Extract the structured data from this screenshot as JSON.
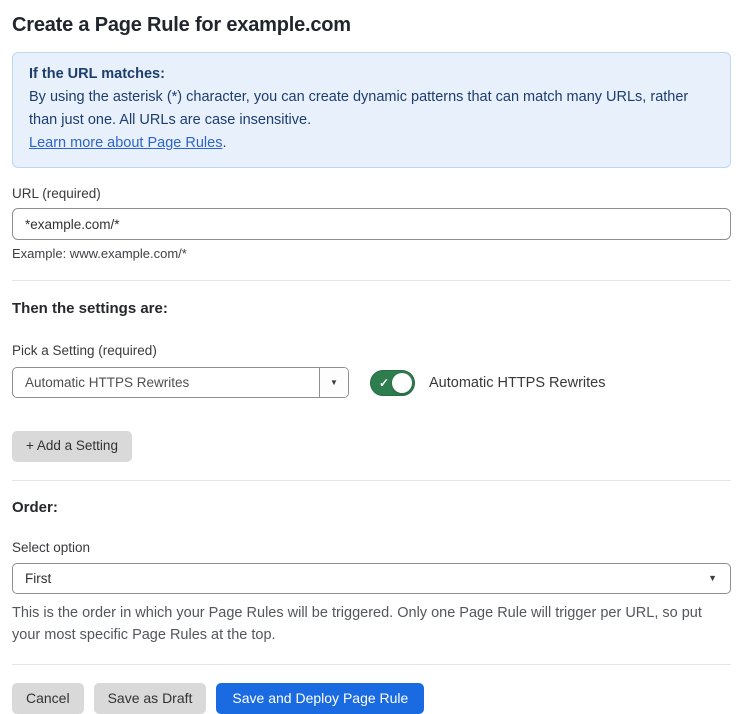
{
  "page_title": "Create a Page Rule for example.com",
  "info_box": {
    "title": "If the URL matches:",
    "body": "By using the asterisk (*) character, you can create dynamic patterns that can match many URLs, rather than just one. All URLs are case insensitive.",
    "link_label": "Learn more about Page Rules",
    "link_suffix": "."
  },
  "url_field": {
    "label": "URL (required)",
    "value": "*example.com/*",
    "hint": "Example: www.example.com/*"
  },
  "settings_section": {
    "heading": "Then the settings are:",
    "picker_label": "Pick a Setting (required)",
    "picker_value": "Automatic HTTPS Rewrites",
    "picker_caret": "▼",
    "toggle": {
      "state": "on",
      "check_glyph": "✓",
      "label": "Automatic HTTPS Rewrites",
      "on_color": "#2e7d4e"
    },
    "add_button_label": "+ Add a Setting"
  },
  "order_section": {
    "heading": "Order:",
    "select_label": "Select option",
    "select_value": "First",
    "select_caret": "▼",
    "hint": "This is the order in which your Page Rules will be triggered. Only one Page Rule will trigger per URL, so put your most specific Page Rules at the top."
  },
  "actions": {
    "cancel_label": "Cancel",
    "save_draft_label": "Save as Draft",
    "deploy_label": "Save and Deploy Page Rule",
    "primary_color": "#1a6be2"
  }
}
